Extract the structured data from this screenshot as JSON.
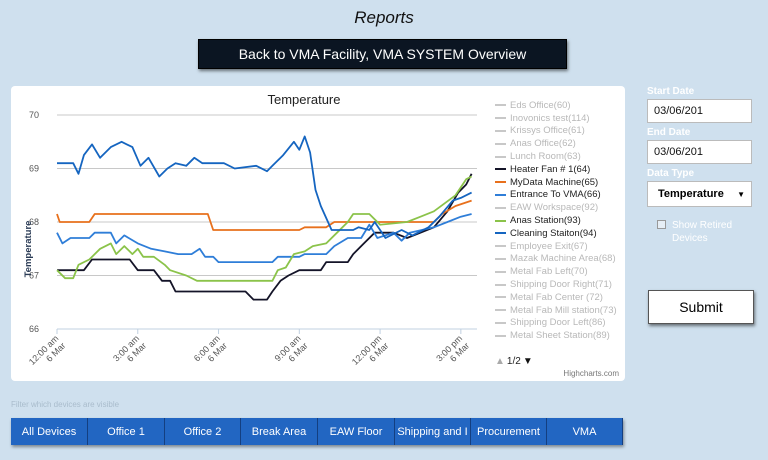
{
  "page": {
    "title": "Reports"
  },
  "back_button": {
    "label": "Back to VMA Facility, VMA SYSTEM Overview"
  },
  "chart_data": {
    "type": "line",
    "title": "Temperature",
    "ylabel": "Temperature",
    "xlabel": "",
    "ylim": [
      66,
      70
    ],
    "y_ticks": [
      "66",
      "67",
      "68",
      "69",
      "70"
    ],
    "x_ticks": [
      "12:00 am 6 Mar",
      "3:00 am 6 Mar",
      "6:00 am 6 Mar",
      "9:00 am 6 Mar",
      "12:00 pm 6 Mar",
      "3:00 pm 6 Mar"
    ],
    "x_hours": [
      0,
      3,
      6,
      9,
      12,
      15
    ],
    "x_range": [
      0,
      15.6
    ],
    "grid": true,
    "legend_placement": "right",
    "series": [
      {
        "name": "Heater Fan # 1(64)",
        "color": "#141428",
        "points": [
          [
            0,
            67.1
          ],
          [
            1.0,
            67.1
          ],
          [
            1.3,
            67.3
          ],
          [
            2.7,
            67.3
          ],
          [
            3.0,
            67.1
          ],
          [
            3.6,
            67.1
          ],
          [
            3.9,
            66.9
          ],
          [
            4.2,
            66.9
          ],
          [
            4.4,
            66.7
          ],
          [
            7.0,
            66.7
          ],
          [
            7.3,
            66.55
          ],
          [
            7.8,
            66.55
          ],
          [
            8.0,
            66.7
          ],
          [
            8.3,
            66.9
          ],
          [
            8.6,
            67.0
          ],
          [
            9.0,
            67.1
          ],
          [
            9.8,
            67.1
          ],
          [
            10.0,
            67.25
          ],
          [
            10.8,
            67.25
          ],
          [
            11.0,
            67.4
          ],
          [
            11.4,
            67.6
          ],
          [
            11.8,
            67.8
          ],
          [
            12.5,
            67.8
          ],
          [
            13.0,
            67.7
          ],
          [
            13.5,
            67.8
          ],
          [
            14.0,
            67.9
          ],
          [
            14.5,
            68.2
          ],
          [
            14.9,
            68.55
          ],
          [
            15.2,
            68.7
          ],
          [
            15.4,
            68.9
          ]
        ]
      },
      {
        "name": "MyData Machine(65)",
        "color": "#e8701c",
        "points": [
          [
            0,
            68.15
          ],
          [
            0.1,
            68.0
          ],
          [
            1.2,
            68.0
          ],
          [
            1.4,
            68.15
          ],
          [
            5.6,
            68.15
          ],
          [
            5.8,
            67.85
          ],
          [
            9.0,
            67.85
          ],
          [
            9.2,
            67.9
          ],
          [
            10.0,
            67.9
          ],
          [
            10.3,
            68.0
          ],
          [
            14.0,
            68.0
          ],
          [
            14.3,
            68.15
          ],
          [
            14.8,
            68.3
          ],
          [
            15.4,
            68.4
          ]
        ]
      },
      {
        "name": "Entrance To VMA(66)",
        "color": "#2f7ed8",
        "points": [
          [
            0,
            67.8
          ],
          [
            0.2,
            67.6
          ],
          [
            0.5,
            67.7
          ],
          [
            1.2,
            67.7
          ],
          [
            1.4,
            67.8
          ],
          [
            2.0,
            67.8
          ],
          [
            2.2,
            67.6
          ],
          [
            2.5,
            67.75
          ],
          [
            3.0,
            67.6
          ],
          [
            3.5,
            67.5
          ],
          [
            4.0,
            67.45
          ],
          [
            4.5,
            67.4
          ],
          [
            5.0,
            67.4
          ],
          [
            5.3,
            67.5
          ],
          [
            5.5,
            67.35
          ],
          [
            5.8,
            67.35
          ],
          [
            6.0,
            67.25
          ],
          [
            8.0,
            67.25
          ],
          [
            8.2,
            67.35
          ],
          [
            9.0,
            67.35
          ],
          [
            9.2,
            67.4
          ],
          [
            10.0,
            67.4
          ],
          [
            10.3,
            67.55
          ],
          [
            10.8,
            67.7
          ],
          [
            11.3,
            67.7
          ],
          [
            11.6,
            67.95
          ],
          [
            11.9,
            67.7
          ],
          [
            12.5,
            67.8
          ],
          [
            12.8,
            67.65
          ],
          [
            13.1,
            67.8
          ],
          [
            14.0,
            67.9
          ],
          [
            14.5,
            68.0
          ],
          [
            15.0,
            68.1
          ],
          [
            15.4,
            68.15
          ]
        ]
      },
      {
        "name": "Anas Station(93)",
        "color": "#8bc34a",
        "points": [
          [
            0,
            67.1
          ],
          [
            0.3,
            66.95
          ],
          [
            0.6,
            66.95
          ],
          [
            0.8,
            67.2
          ],
          [
            1.2,
            67.3
          ],
          [
            1.6,
            67.5
          ],
          [
            2.0,
            67.6
          ],
          [
            2.2,
            67.4
          ],
          [
            2.5,
            67.55
          ],
          [
            2.8,
            67.4
          ],
          [
            3.0,
            67.5
          ],
          [
            3.2,
            67.35
          ],
          [
            3.6,
            67.35
          ],
          [
            4.0,
            67.2
          ],
          [
            4.2,
            67.1
          ],
          [
            4.8,
            67.0
          ],
          [
            5.2,
            66.9
          ],
          [
            8.0,
            66.9
          ],
          [
            8.2,
            67.1
          ],
          [
            8.5,
            67.15
          ],
          [
            8.8,
            67.4
          ],
          [
            9.2,
            67.45
          ],
          [
            9.5,
            67.55
          ],
          [
            10.0,
            67.6
          ],
          [
            10.4,
            67.8
          ],
          [
            10.8,
            68.0
          ],
          [
            11.0,
            68.15
          ],
          [
            11.6,
            68.15
          ],
          [
            12.0,
            67.95
          ],
          [
            13.0,
            68.0
          ],
          [
            13.5,
            68.1
          ],
          [
            14.0,
            68.2
          ],
          [
            14.4,
            68.35
          ],
          [
            14.8,
            68.5
          ],
          [
            15.2,
            68.8
          ],
          [
            15.4,
            68.85
          ]
        ]
      },
      {
        "name": "Cleaning Staiton(94)",
        "color": "#1565c0",
        "points": [
          [
            0,
            69.1
          ],
          [
            0.6,
            69.1
          ],
          [
            0.8,
            68.9
          ],
          [
            1.0,
            69.25
          ],
          [
            1.3,
            69.45
          ],
          [
            1.6,
            69.2
          ],
          [
            2.0,
            69.4
          ],
          [
            2.4,
            69.5
          ],
          [
            2.8,
            69.4
          ],
          [
            3.1,
            69.05
          ],
          [
            3.4,
            69.2
          ],
          [
            3.8,
            68.85
          ],
          [
            4.1,
            69.0
          ],
          [
            4.4,
            69.1
          ],
          [
            4.8,
            69.05
          ],
          [
            5.1,
            69.2
          ],
          [
            5.4,
            69.1
          ],
          [
            6.2,
            69.1
          ],
          [
            6.6,
            69.0
          ],
          [
            7.4,
            69.05
          ],
          [
            7.8,
            68.95
          ],
          [
            8.0,
            69.05
          ],
          [
            8.4,
            69.25
          ],
          [
            8.8,
            69.5
          ],
          [
            9.0,
            69.35
          ],
          [
            9.2,
            69.6
          ],
          [
            9.4,
            69.3
          ],
          [
            9.6,
            68.6
          ],
          [
            9.8,
            68.3
          ],
          [
            10.2,
            67.85
          ],
          [
            11.0,
            67.85
          ],
          [
            11.2,
            67.9
          ],
          [
            11.6,
            67.85
          ],
          [
            11.8,
            68.0
          ],
          [
            12.2,
            67.7
          ],
          [
            12.8,
            67.85
          ],
          [
            13.2,
            67.75
          ],
          [
            13.8,
            67.9
          ],
          [
            14.2,
            68.1
          ],
          [
            14.7,
            68.4
          ],
          [
            15.0,
            68.45
          ],
          [
            15.4,
            68.55
          ]
        ]
      }
    ]
  },
  "legend": {
    "items": [
      {
        "label": "Eds Office(60)",
        "visible": false,
        "color": "#cccccc"
      },
      {
        "label": "Inovonics test(114)",
        "visible": false,
        "color": "#cccccc"
      },
      {
        "label": "Krissys Office(61)",
        "visible": false,
        "color": "#cccccc"
      },
      {
        "label": "Anas Office(62)",
        "visible": false,
        "color": "#cccccc"
      },
      {
        "label": "Lunch Room(63)",
        "visible": false,
        "color": "#cccccc"
      },
      {
        "label": "Heater Fan # 1(64)",
        "visible": true,
        "color": "#141428"
      },
      {
        "label": "MyData Machine(65)",
        "visible": true,
        "color": "#e8701c"
      },
      {
        "label": "Entrance To VMA(66)",
        "visible": true,
        "color": "#2f7ed8"
      },
      {
        "label": "EAW Workspace(92)",
        "visible": false,
        "color": "#cccccc"
      },
      {
        "label": "Anas Station(93)",
        "visible": true,
        "color": "#8bc34a"
      },
      {
        "label": "Cleaning Staiton(94)",
        "visible": true,
        "color": "#1565c0"
      },
      {
        "label": "Employee Exit(67)",
        "visible": false,
        "color": "#cccccc"
      },
      {
        "label": "Mazak Machine Area(68)",
        "visible": false,
        "color": "#cccccc"
      },
      {
        "label": "Metal Fab Left(70)",
        "visible": false,
        "color": "#cccccc"
      },
      {
        "label": "Shipping Door Right(71)",
        "visible": false,
        "color": "#cccccc"
      },
      {
        "label": "Metal Fab Center (72)",
        "visible": false,
        "color": "#cccccc"
      },
      {
        "label": "Metal Fab Mill station(73)",
        "visible": false,
        "color": "#cccccc"
      },
      {
        "label": "Shipping Door Left(86)",
        "visible": false,
        "color": "#cccccc"
      },
      {
        "label": "Metal Sheet Station(89)",
        "visible": false,
        "color": "#cccccc"
      }
    ],
    "pager": "1/2",
    "pager_up_icon": "triangle-up",
    "pager_down_icon": "triangle-down"
  },
  "credits": "Highcharts.com",
  "controls": {
    "start_date_label": "Start Date",
    "start_date_value": "03/06/201",
    "end_date_label": "End Date",
    "end_date_value": "03/06/201",
    "data_type_label": "Data Type",
    "data_type_value": "Temperature",
    "data_type_arrow": "▼",
    "show_retired_label": "Show Retired Devices",
    "show_retired_checked": false,
    "submit_label": "Submit"
  },
  "filter_hint": "Filter which devices are visible",
  "tabs": [
    {
      "label": "All Devices"
    },
    {
      "label": "Office 1"
    },
    {
      "label": "Office 2"
    },
    {
      "label": "Break Area"
    },
    {
      "label": "EAW Floor"
    },
    {
      "label": "Shipping and I"
    },
    {
      "label": "Procurement"
    },
    {
      "label": "VMA"
    }
  ]
}
